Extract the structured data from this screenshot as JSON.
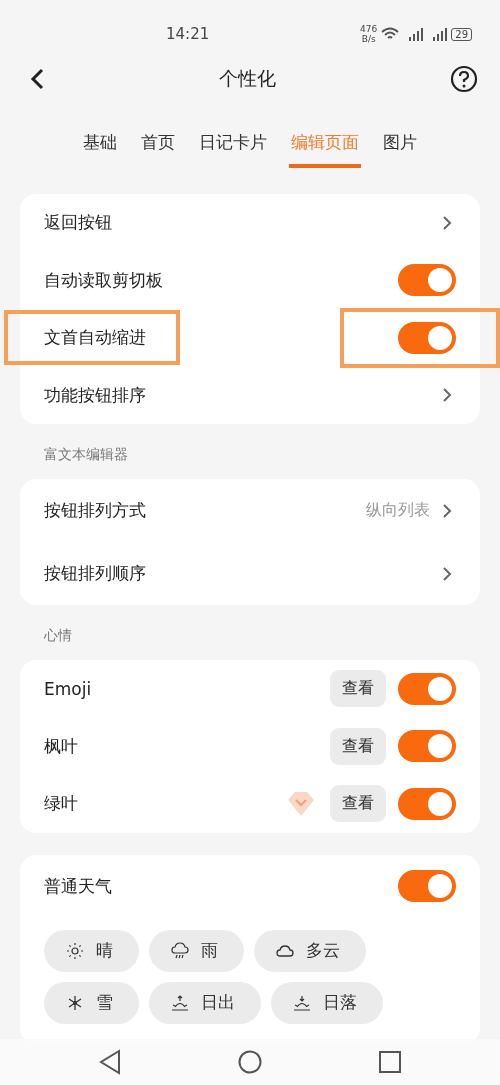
{
  "status_bar": {
    "time": "14:21",
    "speed": "476",
    "speed_unit": "B/s",
    "battery": "29"
  },
  "header": {
    "title": "个性化"
  },
  "tabs": [
    {
      "label": "基础",
      "selected": false
    },
    {
      "label": "首页",
      "selected": false
    },
    {
      "label": "日记卡片",
      "selected": false
    },
    {
      "label": "编辑页面",
      "selected": true
    },
    {
      "label": "图片",
      "selected": false
    }
  ],
  "sections": [
    {
      "rows": [
        {
          "kind": "link",
          "label": "返回按钮"
        },
        {
          "kind": "toggle",
          "label": "自动读取剪切板",
          "on": true
        },
        {
          "kind": "toggle",
          "label": "文首自动缩进",
          "on": true,
          "highlighted": true
        },
        {
          "kind": "link",
          "label": "功能按钮排序"
        }
      ]
    },
    {
      "heading": "富文本编辑器",
      "rows": [
        {
          "kind": "link",
          "label": "按钮排列方式",
          "value": "纵向列表"
        },
        {
          "kind": "link",
          "label": "按钮排列顺序"
        }
      ]
    },
    {
      "heading": "心情",
      "rows": [
        {
          "kind": "toggle",
          "label": "Emoji",
          "on": true,
          "view": "查看"
        },
        {
          "kind": "toggle",
          "label": "枫叶",
          "on": true,
          "view": "查看"
        },
        {
          "kind": "toggle",
          "label": "绿叶",
          "on": true,
          "view": "查看",
          "premium": true
        }
      ]
    },
    {
      "rows": [
        {
          "kind": "toggle",
          "label": "普通天气",
          "on": true
        }
      ],
      "chips": [
        {
          "kind": "sun",
          "label": "晴"
        },
        {
          "kind": "rain",
          "label": "雨"
        },
        {
          "kind": "cloud",
          "label": "多云"
        },
        {
          "kind": "snow",
          "label": "雪"
        },
        {
          "kind": "sunrise",
          "label": "日出"
        },
        {
          "kind": "sunset",
          "label": "日落"
        }
      ]
    }
  ]
}
